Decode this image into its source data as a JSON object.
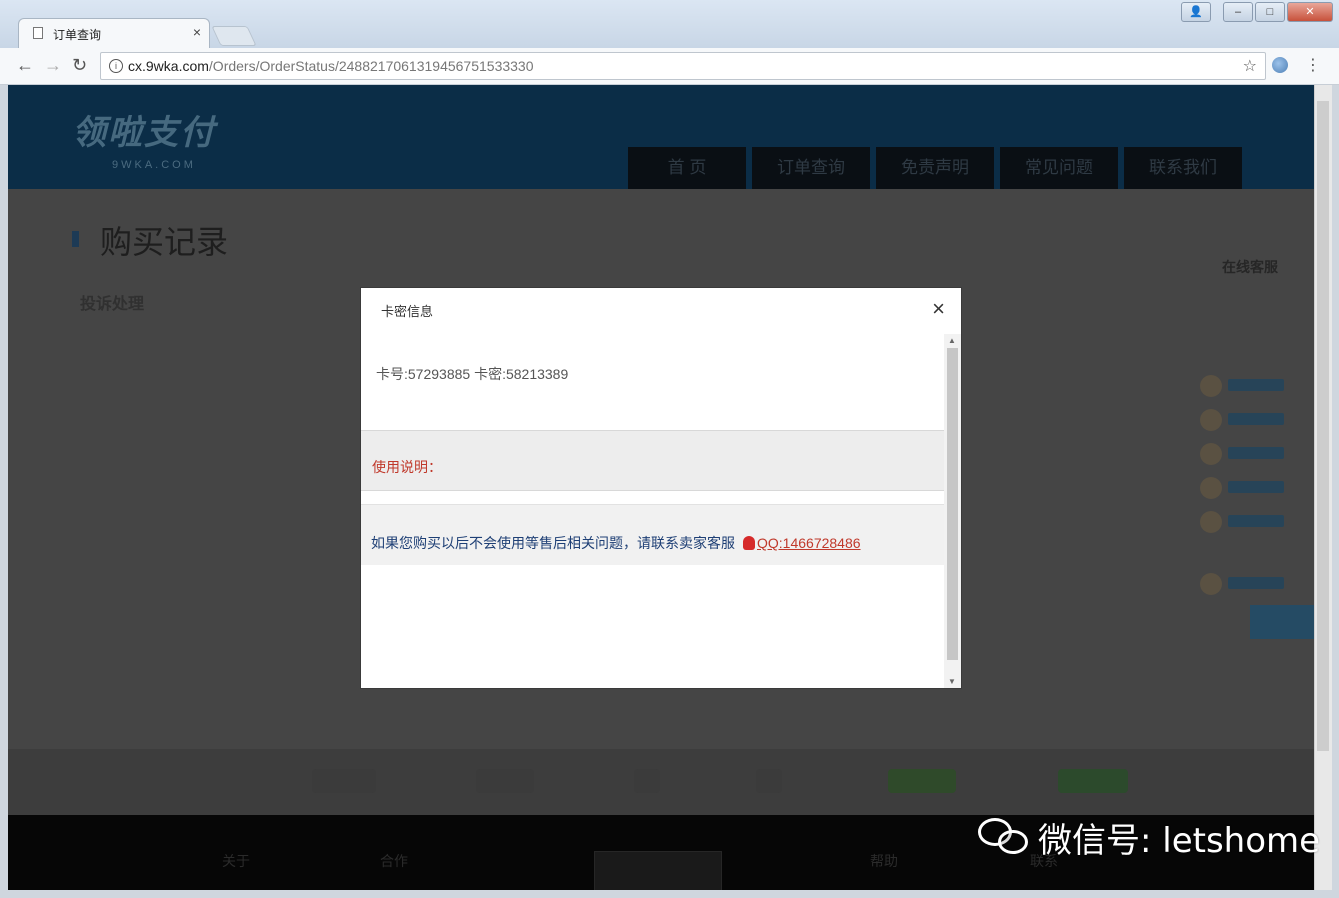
{
  "browser": {
    "tab_title": "订单查询",
    "tab_close": "×",
    "url_host": "cx.9wka.com",
    "url_path": "/Orders/OrderStatus/2488217061319456751533330",
    "back": "←",
    "forward": "→",
    "reload": "↻",
    "info": "i",
    "star": "☆",
    "menu": "⋮",
    "window_buttons": {
      "minimize": "‒",
      "maximize": "□",
      "close": "✕",
      "user": "👤"
    }
  },
  "site": {
    "logo": "领啦支付",
    "logo_sub": "9WKA.COM",
    "nav": [
      "首 页",
      "订单查询",
      "免责声明",
      "常见问题",
      "联系我们"
    ]
  },
  "page": {
    "title": "购买记录",
    "side_title": "在线客服",
    "left_heading": "投诉处理",
    "footer": [
      "关于",
      "合作",
      "帮助",
      "联系"
    ]
  },
  "modal": {
    "title": "卡密信息",
    "close": "×",
    "card_line": "卡号:57293885 卡密:58213389",
    "usage_label": "使用说明：",
    "contact_text": "如果您购买以后不会使用等售后相关问题，请联系卖家客服",
    "qq_link": "QQ:1466728486",
    "scroll_up": "▲",
    "scroll_down": "▼"
  },
  "watermark": {
    "text": "微信号: letshome"
  },
  "colors": {
    "header_bg": "#0b2d47",
    "usage_red": "#c0392b",
    "contact_blue": "#1e3f75"
  }
}
